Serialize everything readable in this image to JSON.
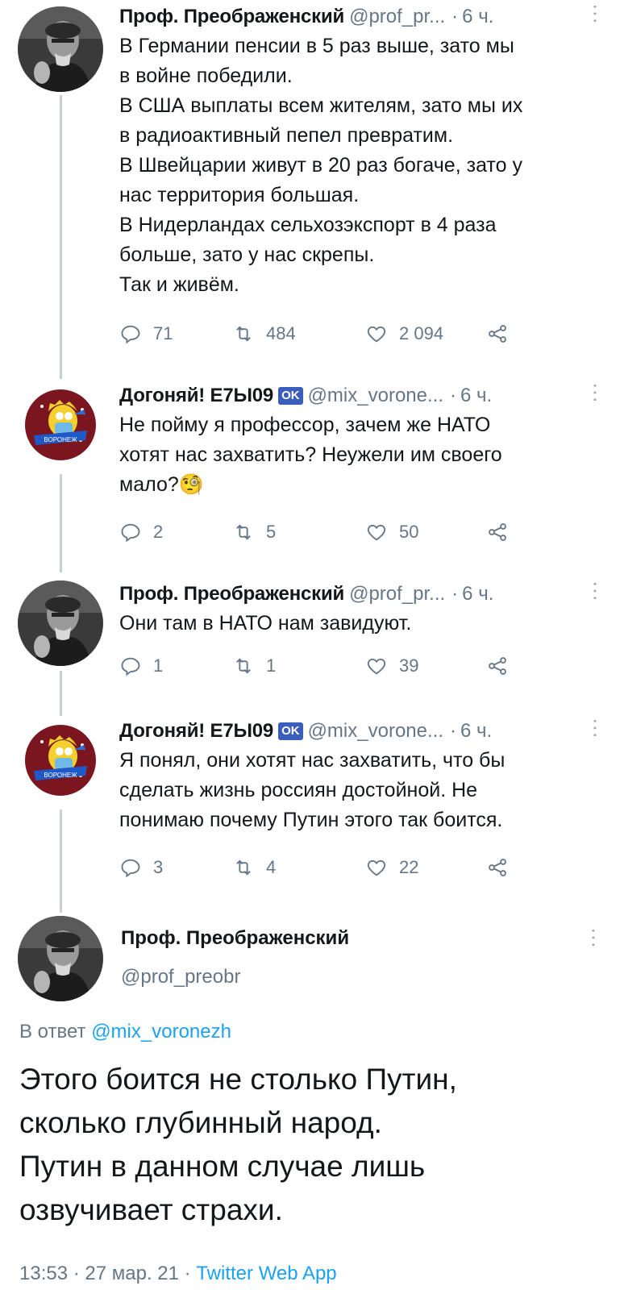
{
  "tweets": [
    {
      "name": "Проф. Преображенский",
      "handle": "@prof_pr...",
      "time": "6 ч.",
      "text": "В Германии пенсии в 5 раз выше, зато мы\nв войне победили.\nВ США выплаты всем жителям, зато мы их\nв радиоактивный пепел превратим.\nВ Швейцарии живут в 20 раз богаче, зато у\nнас территория большая.\nВ Нидерландах сельхозэкспорт в 4 раза\nбольше, зато у нас скрепы.\nТак и живём.",
      "replies": "71",
      "retweets": "484",
      "likes": "2 094"
    },
    {
      "name": "Догоняй! E7Ы09",
      "badge": "OK",
      "handle": "@mix_vorone...",
      "time": "6 ч.",
      "text": "Не пойму я профессор, зачем же НАТО\nхотят нас захватить? Неужели им своего\nмало?🧐",
      "replies": "2",
      "retweets": "5",
      "likes": "50"
    },
    {
      "name": "Проф. Преображенский",
      "handle": "@prof_pr...",
      "time": "6 ч.",
      "text": "Они там в НАТО нам завидуют.",
      "replies": "1",
      "retweets": "1",
      "likes": "39"
    },
    {
      "name": "Догоняй! E7Ы09",
      "badge": "OK",
      "handle": "@mix_vorone...",
      "time": "6 ч.",
      "text": "Я понял, они хотят нас захватить, что бы\nсделать жизнь россиян достойной. Не\nпонимаю почему Путин этого так боится.",
      "replies": "3",
      "retweets": "4",
      "likes": "22"
    }
  ],
  "main": {
    "name": "Проф. Преображенский",
    "handle": "@prof_preobr",
    "reply_prefix": "В ответ",
    "reply_to": "@mix_voronezh",
    "text": "Этого боится не столько Путин,\nсколько глубинный народ.\nПутин в данном случае лишь\nозвучивает страхи.",
    "time": "13:53",
    "date": "27 мар. 21",
    "source": "Twitter Web App",
    "sep": "·"
  },
  "avatar_text": "ВОРОНЕЖ",
  "colors": {
    "muted": "#657786",
    "link": "#1da1f2",
    "thread": "#c4cfd6",
    "badge": "#3b5dbc"
  }
}
